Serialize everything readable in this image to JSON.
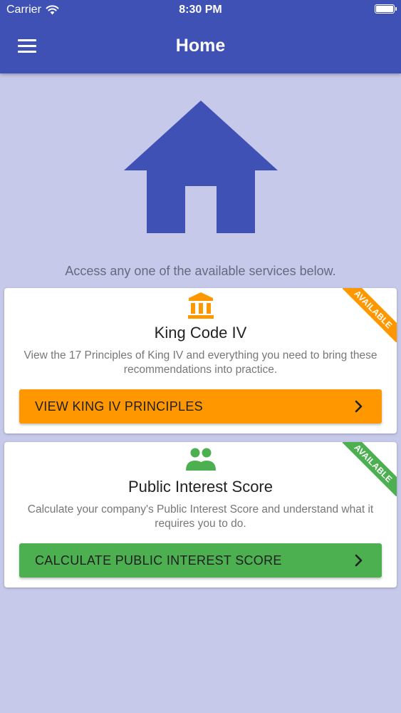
{
  "status_bar": {
    "carrier": "Carrier",
    "time": "8:30 PM"
  },
  "header": {
    "title": "Home"
  },
  "intro_text": "Access any one of the available services below.",
  "cards": [
    {
      "icon": "bank-icon",
      "title": "King Code IV",
      "description": "View the 17 Principles of King IV and everything you need to bring these recommendations into practice.",
      "button_label": "VIEW KING IV PRINCIPLES",
      "ribbon": "AVAILABLE",
      "accent": "#ff9800"
    },
    {
      "icon": "people-icon",
      "title": "Public Interest Score",
      "description": "Calculate your company's Public Interest Score and understand what it requires you to do.",
      "button_label": "CALCULATE PUBLIC INTEREST SCORE",
      "ribbon": "AVAILABLE",
      "accent": "#4caf50"
    }
  ],
  "colors": {
    "primary": "#3f51b5",
    "background": "#c6c9ea",
    "orange": "#ff9800",
    "green": "#4caf50"
  }
}
